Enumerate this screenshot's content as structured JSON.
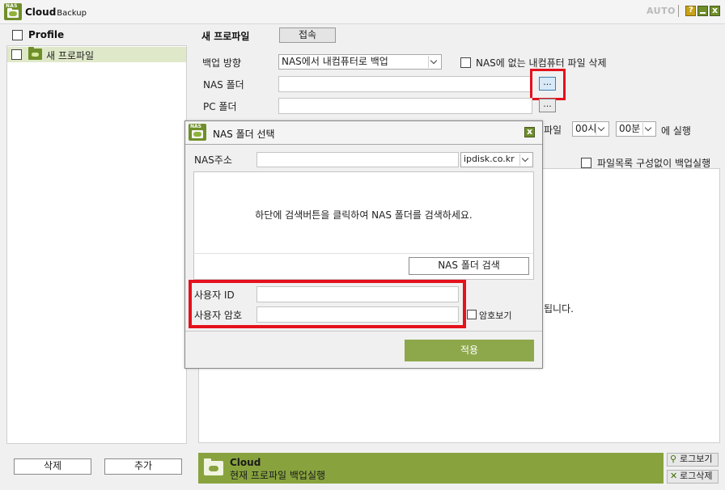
{
  "window": {
    "title_bold": "Cloud",
    "title_small": "Backup",
    "logo_text": "NAS",
    "auto_label": "AUTO",
    "help_glyph": "?",
    "close_glyph": "x"
  },
  "profiles": {
    "header_label": "Profile",
    "items": [
      {
        "label": "새 프로파일",
        "checked": false,
        "selected": true
      }
    ],
    "delete_button": "삭제",
    "add_button": "추가"
  },
  "profile_form": {
    "title": "새 프로파일",
    "connect_button": "접속",
    "direction_label": "백업 방향",
    "direction_value": "NAS에서 내컴퓨터로 백업",
    "delete_missing_label": "NAS에 없는 내컴퓨터 파일 삭제",
    "nas_folder_label": "NAS 폴더",
    "nas_folder_value": "",
    "pc_folder_label": "PC 폴더",
    "pc_folder_value": "",
    "browse_glyph": "...",
    "schedule_suffix_label": "파일",
    "schedule_hour": "00시",
    "schedule_minute": "00분",
    "run_label": "에 실행",
    "no_list_label": "파일목록 구성없이 백업실행",
    "partial_text": "됩니다."
  },
  "status_bar": {
    "title": "Cloud",
    "subtitle": "현재 프로파일 백업실행",
    "log_view_button": "로그보기",
    "log_delete_button": "로그삭제"
  },
  "dialog": {
    "title": "NAS 폴더 선택",
    "logo_text": "NAS",
    "close_glyph": "x",
    "nas_address_label": "NAS주소",
    "nas_address_value": "",
    "domain_value": "ipdisk.co.kr",
    "message": "하단에 검색버튼을 클릭하여 NAS 폴더를 검색하세요.",
    "search_button": "NAS 폴더 검색",
    "user_id_label": "사용자 ID",
    "user_id_value": "",
    "user_pw_label": "사용자 암호",
    "user_pw_value": "",
    "show_pw_label": "암호보기",
    "apply_button": "적용"
  },
  "colors": {
    "accent_green": "#88a33e",
    "apply_green": "#8da84a",
    "highlight_red": "#e5111c",
    "selection_green": "#dfe9c9"
  }
}
